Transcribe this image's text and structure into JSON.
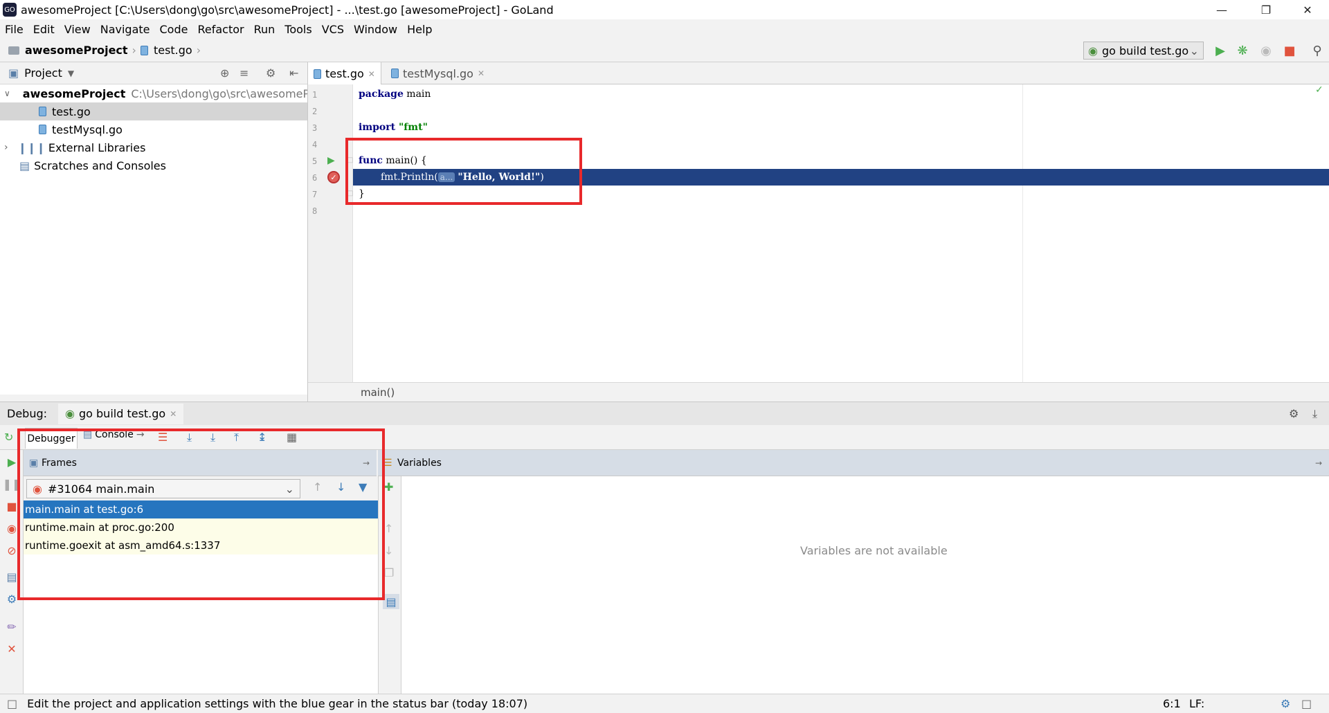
{
  "window": {
    "title": "awesomeProject [C:\\Users\\dong\\go\\src\\awesomeProject] - ...\\test.go [awesomeProject] - GoLand"
  },
  "menu": [
    "File",
    "Edit",
    "View",
    "Navigate",
    "Code",
    "Refactor",
    "Run",
    "Tools",
    "VCS",
    "Window",
    "Help"
  ],
  "nav": {
    "project": "awesomeProject",
    "file": "test.go"
  },
  "run_config": "go build test.go",
  "project_panel": {
    "label": "Project",
    "root_name": "awesomeProject",
    "root_path": "C:\\Users\\dong\\go\\src\\awesomeProj",
    "files": [
      "test.go",
      "testMysql.go"
    ],
    "external": "External Libraries",
    "scratches": "Scratches and Consoles"
  },
  "editor": {
    "tabs": [
      "test.go",
      "testMysql.go"
    ],
    "line_numbers": [
      "1",
      "2",
      "3",
      "4",
      "5",
      "6",
      "7",
      "8"
    ],
    "code": {
      "l1_kw": "package",
      "l1_rest": " main",
      "l3_kw": "import",
      "l3_str": " \"fmt\"",
      "l5_kw": "func",
      "l5_rest": " main() {",
      "l6_call": "fmt.Println(",
      "l6_hint": "a...",
      "l6_str": "\"Hello, World!\"",
      "l6_end": ")",
      "l7": "}"
    },
    "breadcrumb": "main()"
  },
  "debug": {
    "label": "Debug:",
    "session": "go build test.go",
    "tabs": [
      "Debugger",
      "Console"
    ],
    "frames_title": "Frames",
    "thread": "#31064 main.main",
    "frames": [
      "main.main at test.go:6",
      "runtime.main at proc.go:200",
      "runtime.goexit at asm_amd64.s:1337"
    ],
    "variables_title": "Variables",
    "variables_empty": "Variables are not available"
  },
  "status": {
    "message": "Edit the project and application settings with the blue gear in the status bar (today 18:07)",
    "position": "6:1",
    "line_sep": "LF:"
  },
  "colors": {
    "highlight": "#214283",
    "selection": "#2675bf",
    "annotation": "#e8292b"
  }
}
